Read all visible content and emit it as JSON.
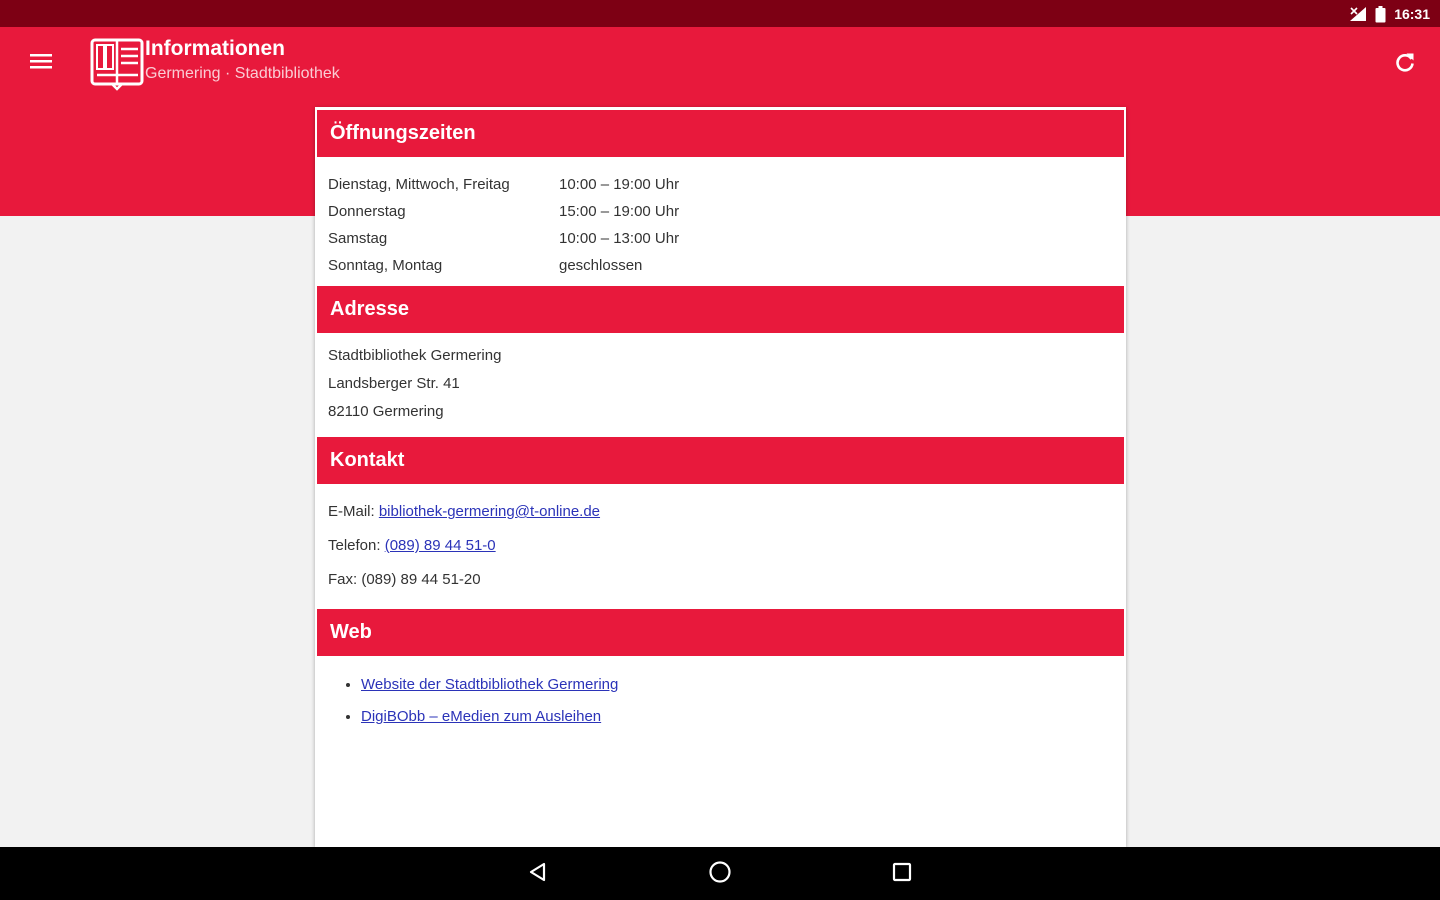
{
  "status_bar": {
    "time": "16:31"
  },
  "app_bar": {
    "title": "Informationen",
    "subtitle": "Germering · Stadtbibliothek"
  },
  "sections": {
    "hours": {
      "header": "Öffnungszeiten",
      "rows": [
        {
          "day": "Dienstag, Mittwoch, Freitag",
          "time": "10:00 – 19:00 Uhr"
        },
        {
          "day": "Donnerstag",
          "time": "15:00 – 19:00 Uhr"
        },
        {
          "day": "Samstag",
          "time": "10:00 – 13:00 Uhr"
        },
        {
          "day": "Sonntag, Montag",
          "time": "geschlossen"
        }
      ]
    },
    "address": {
      "header": "Adresse",
      "lines": [
        "Stadtbibliothek Germering",
        "Landsberger Str. 41",
        "82110 Germering"
      ]
    },
    "contact": {
      "header": "Kontakt",
      "email_label": "E-Mail: ",
      "email": "bibliothek-germering@t-online.de",
      "phone_label": "Telefon: ",
      "phone": "(089) 89 44 51-0",
      "fax": "Fax: (089) 89 44 51-20"
    },
    "web": {
      "header": "Web",
      "links": [
        "Website der Stadtbibliothek Germering",
        "DigiBObb – eMedien zum Ausleihen"
      ]
    }
  },
  "colors": {
    "primary": "#e8193c",
    "status_bar": "#7d0014",
    "link": "#2b33b8"
  }
}
